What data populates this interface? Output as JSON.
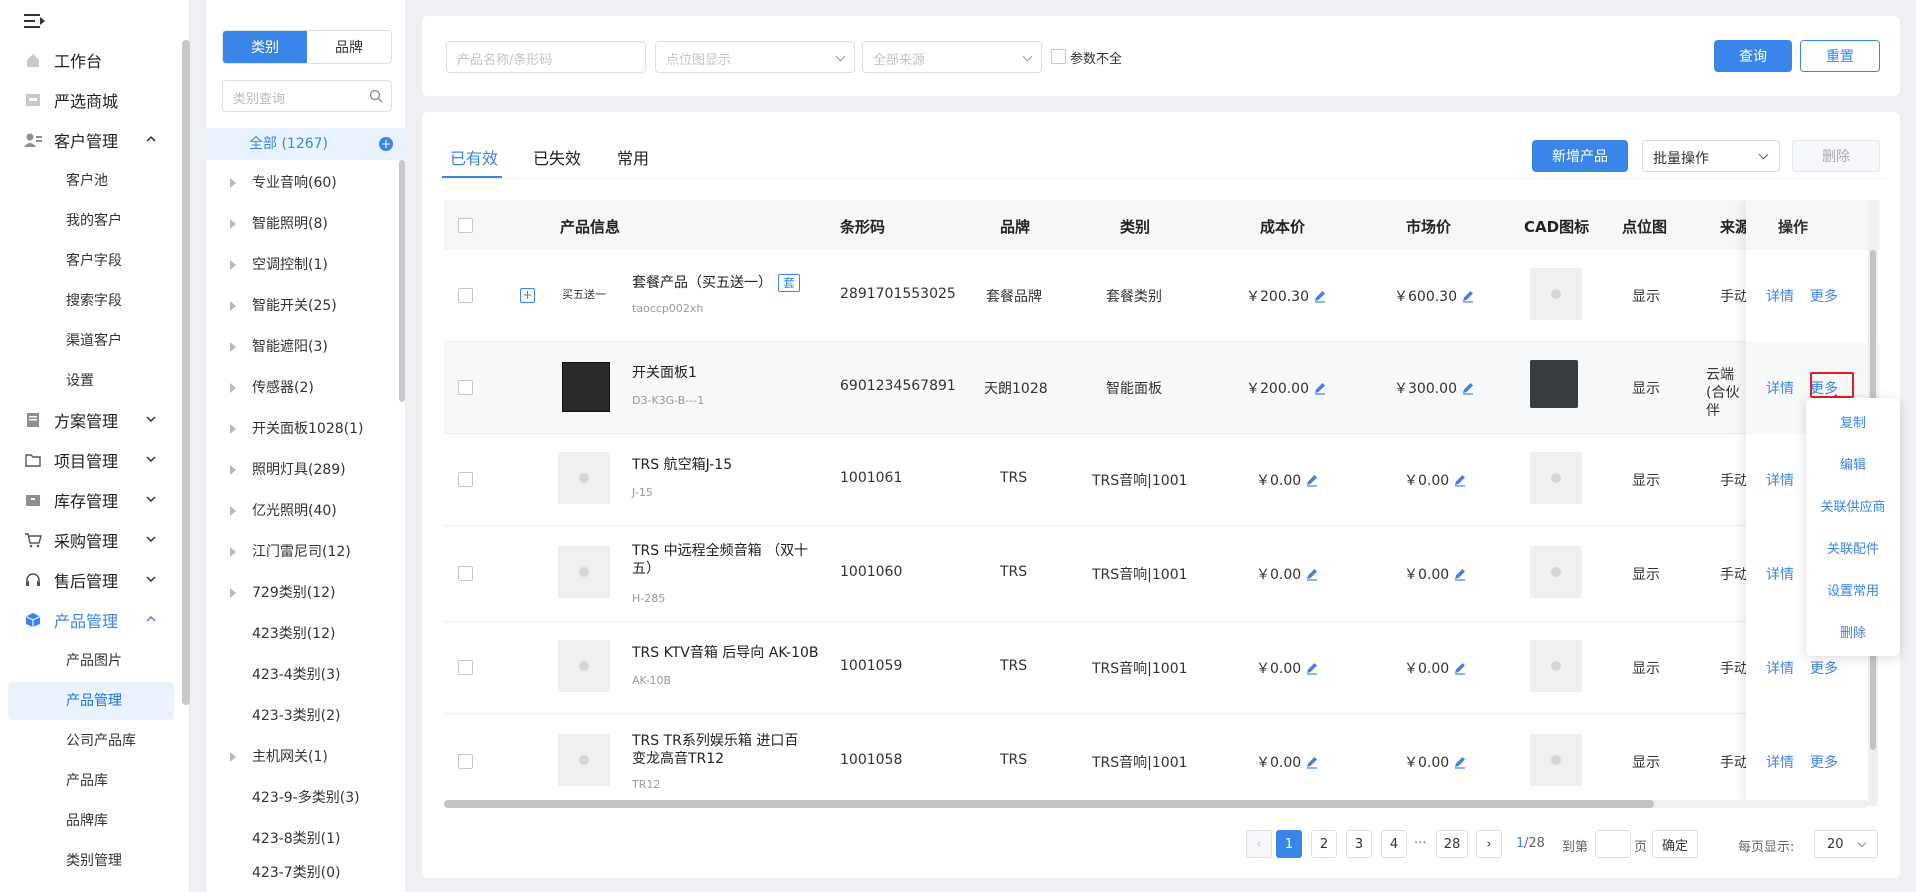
{
  "nav": {
    "items": [
      {
        "label": "工作台",
        "icon": "home-icon"
      },
      {
        "label": "严选商城",
        "icon": "store-icon"
      },
      {
        "label": "客户管理",
        "icon": "users-icon"
      },
      {
        "label": "方案管理",
        "icon": "document-icon"
      },
      {
        "label": "项目管理",
        "icon": "folder-icon"
      },
      {
        "label": "库存管理",
        "icon": "box-icon"
      },
      {
        "label": "采购管理",
        "icon": "cart-icon"
      },
      {
        "label": "售后管理",
        "icon": "headset-icon"
      },
      {
        "label": "产品管理",
        "icon": "cube-icon"
      }
    ],
    "customer_sub": [
      "客户池",
      "我的客户",
      "客户字段",
      "搜索字段",
      "渠道客户",
      "设置"
    ],
    "product_sub": [
      "产品图片",
      "产品管理",
      "公司产品库",
      "产品库",
      "品牌库",
      "类别管理"
    ],
    "accent": "#3a86e8"
  },
  "catpanel": {
    "seg_category": "类别",
    "seg_brand": "品牌",
    "search_placeholder": "类别查询",
    "all": "全部 (1267)",
    "items": [
      "专业音响(60)",
      "智能照明(8)",
      "空调控制(1)",
      "智能开关(25)",
      "智能遮阳(3)",
      "传感器(2)",
      "开关面板1028(1)",
      "照明灯具(289)",
      "亿光照明(40)",
      "江门雷尼司(12)",
      "729类别(12)",
      "423类别(12)",
      "423-4类别(3)",
      "423-3类别(2)",
      "主机网关(1)",
      "423-9-多类别(3)",
      "423-8类别(1)",
      "423-7类别(0)"
    ]
  },
  "filter": {
    "name_placeholder": "产品名称/条形码",
    "point_placeholder": "点位图显示",
    "source_placeholder": "全部来源",
    "param_label": "参数不全",
    "query": "查询",
    "reset": "重置"
  },
  "tabs": [
    "已有效",
    "已失效",
    "常用"
  ],
  "toolbar": {
    "add": "新增产品",
    "batch": "批量操作",
    "delete": "删除"
  },
  "columns": [
    "产品信息",
    "条形码",
    "品牌",
    "类别",
    "成本价",
    "市场价",
    "CAD图标",
    "点位图",
    "来源",
    "操作"
  ],
  "rows": [
    {
      "name": "套餐产品（买五送一）",
      "code": "taoccp002xh",
      "barcode": "2891701553025",
      "brand": "套餐品牌",
      "category": "套餐类别",
      "cost": "￥200.30",
      "market": "￥600.30",
      "point": "显示",
      "source": "手动",
      "thumb_text": "买五送一",
      "tag": "套"
    },
    {
      "name": "开关面板1",
      "code": "D3-K3G-B---1",
      "barcode": "6901234567891",
      "brand": "天朗1028",
      "category": "智能面板",
      "cost": "￥200.00",
      "market": "￥300.00",
      "point": "显示",
      "source": "云端(合伙伴"
    },
    {
      "name": "TRS 航空箱J-15",
      "code": "J-15",
      "barcode": "1001061",
      "brand": "TRS",
      "category": "TRS音响|1001",
      "cost": "￥0.00",
      "market": "￥0.00",
      "point": "显示",
      "source": "手动"
    },
    {
      "name": "TRS 中远程全频音箱 （双十五）",
      "code": "H-285",
      "barcode": "1001060",
      "brand": "TRS",
      "category": "TRS音响|1001",
      "cost": "￥0.00",
      "market": "￥0.00",
      "point": "显示",
      "source": "手动"
    },
    {
      "name": "TRS KTV音箱 后导向 AK-10B",
      "code": "AK-10B",
      "barcode": "1001059",
      "brand": "TRS",
      "category": "TRS音响|1001",
      "cost": "￥0.00",
      "market": "￥0.00",
      "point": "显示",
      "source": "手动"
    },
    {
      "name": "TRS TR系列娱乐箱 进口百变龙高音TR12",
      "code": "TR12",
      "barcode": "1001058",
      "brand": "TRS",
      "category": "TRS音响|1001",
      "cost": "￥0.00",
      "market": "￥0.00",
      "point": "显示",
      "source": "手动"
    }
  ],
  "actions": {
    "detail": "详情",
    "more": "更多"
  },
  "popover": [
    "复制",
    "编辑",
    "关联供应商",
    "关联配件",
    "设置常用",
    "删除"
  ],
  "pagination": {
    "pages": [
      "1",
      "2",
      "3",
      "4",
      "···",
      "28"
    ],
    "current": "1",
    "total": "/28",
    "goto": "到第",
    "page_unit": "页",
    "confirm": "确定",
    "per_page_label": "每页显示:",
    "per_page": "20"
  }
}
